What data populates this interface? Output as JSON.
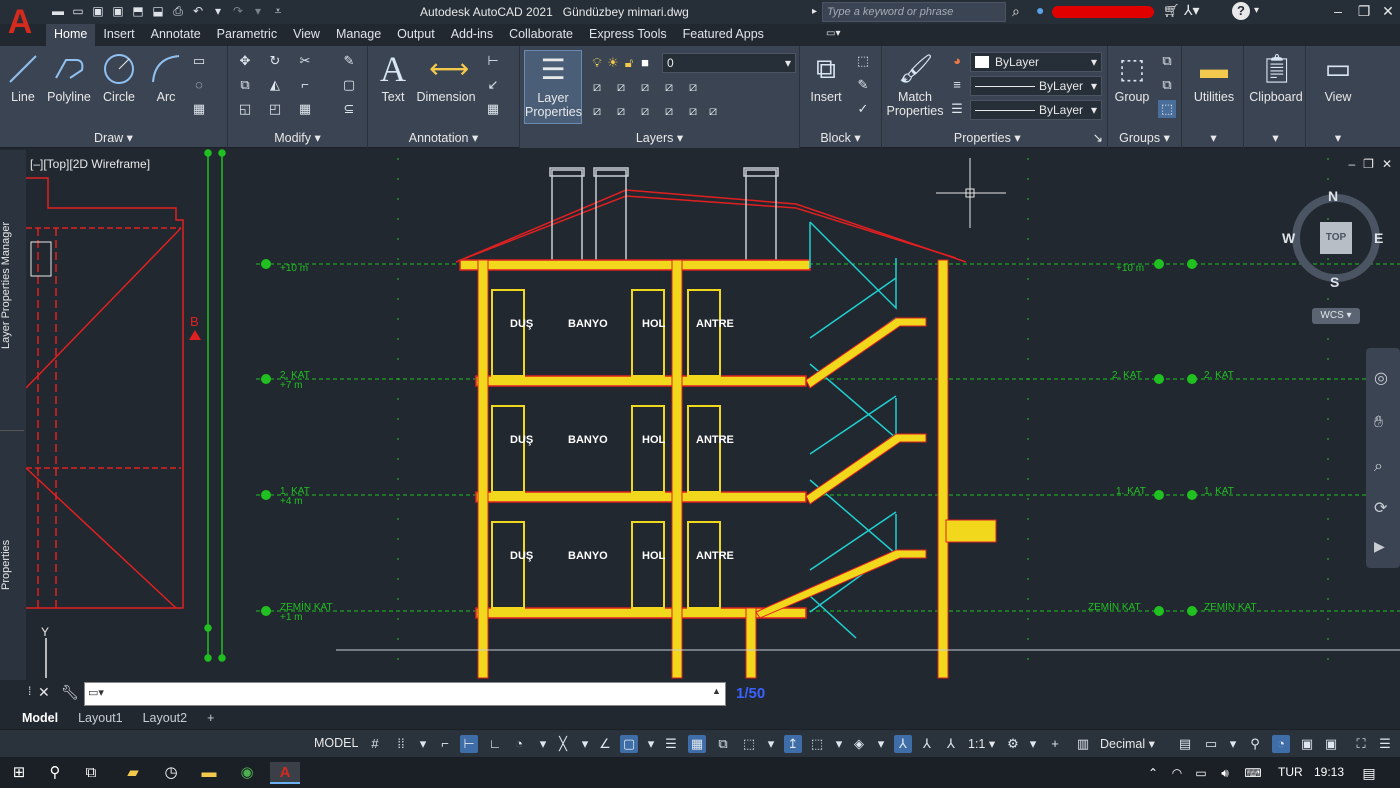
{
  "titlebar": {
    "app_title": "Autodesk AutoCAD 2021",
    "file_name": "Gündüzbey mimari.dwg",
    "search_placeholder": "Type a keyword or phrase",
    "app_logo_letter": "A"
  },
  "ribbon_tabs": [
    "Home",
    "Insert",
    "Annotate",
    "Parametric",
    "View",
    "Manage",
    "Output",
    "Add-ins",
    "Collaborate",
    "Express Tools",
    "Featured Apps"
  ],
  "ribbon": {
    "draw": {
      "label": "Draw",
      "tools": [
        "Line",
        "Polyline",
        "Circle",
        "Arc"
      ]
    },
    "modify": {
      "label": "Modify"
    },
    "annotation": {
      "label": "Annotation",
      "text": "Text",
      "dimension": "Dimension"
    },
    "layers": {
      "label": "Layers",
      "layer_properties": "Layer Properties",
      "current_layer": "0"
    },
    "block": {
      "label": "Block",
      "insert": "Insert"
    },
    "properties": {
      "label": "Properties",
      "match": "Match Properties",
      "color": "ByLayer",
      "linetype": "ByLayer",
      "lineweight": "ByLayer"
    },
    "groups": {
      "label": "Groups",
      "group": "Group"
    },
    "utilities": {
      "label": "Utilities"
    },
    "clipboard": {
      "label": "Clipboard"
    },
    "view": {
      "label": "View"
    }
  },
  "sidebar": {
    "layer_manager": "Layer Properties Manager",
    "properties": "Properties"
  },
  "viewport": {
    "label": "[–][Top][2D Wireframe]"
  },
  "viewcube": {
    "north": "N",
    "south": "S",
    "east": "E",
    "west": "W",
    "top": "TOP",
    "ucs": "WCS"
  },
  "drawing": {
    "levels": [
      {
        "name": "",
        "elev": "+10 m"
      },
      {
        "name": "2. KAT",
        "elev": "+7 m"
      },
      {
        "name": "1. KAT",
        "elev": "+4 m"
      },
      {
        "name": "ZEMİN KAT",
        "elev": "+1 m"
      }
    ],
    "rooms": [
      "DUŞ",
      "BANYO",
      "HOL",
      "ANTRE"
    ],
    "marker": "B"
  },
  "command_line": {
    "scale_text": "1/50"
  },
  "layout_tabs": [
    "Model",
    "Layout1",
    "Layout2"
  ],
  "statusbar": {
    "model": "MODEL",
    "scale": "1:1",
    "units": "Decimal"
  },
  "taskbar": {
    "lang": "TUR",
    "time": "19:13"
  }
}
